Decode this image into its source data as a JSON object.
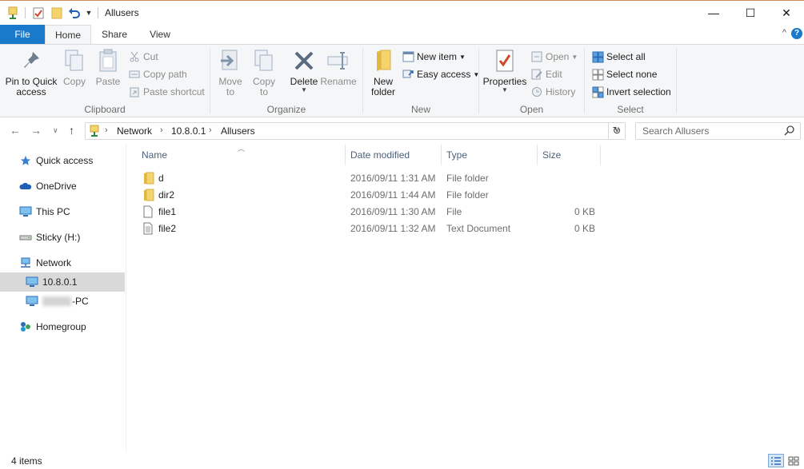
{
  "window": {
    "title": "Allusers",
    "minimize_glyph": "—",
    "maximize_glyph": "☐",
    "close_glyph": "✕"
  },
  "tabs": [
    {
      "label": "File"
    },
    {
      "label": "Home"
    },
    {
      "label": "Share"
    },
    {
      "label": "View"
    }
  ],
  "help_glyph": "?",
  "ribbon_caret": "^",
  "ribbon": {
    "clipboard": {
      "label": "Clipboard",
      "pin_label": "Pin to Quick\naccess",
      "copy_label": "Copy",
      "paste_label": "Paste",
      "cut_label": "Cut",
      "copy_path_label": "Copy path",
      "paste_shortcut_label": "Paste shortcut"
    },
    "organize": {
      "label": "Organize",
      "move_to_label": "Move\nto",
      "copy_to_label": "Copy\nto",
      "delete_label": "Delete",
      "rename_label": "Rename"
    },
    "new": {
      "label": "New",
      "new_folder_label": "New\nfolder",
      "new_item_label": "New item",
      "easy_access_label": "Easy access"
    },
    "open": {
      "label": "Open",
      "properties_label": "Properties",
      "open_label": "Open",
      "edit_label": "Edit",
      "history_label": "History"
    },
    "select": {
      "label": "Select",
      "select_all_label": "Select all",
      "select_none_label": "Select none",
      "invert_label": "Invert selection"
    }
  },
  "address": {
    "crumbs": [
      "Network",
      "10.8.0.1",
      "Allusers"
    ],
    "search_placeholder": "Search Allusers"
  },
  "nav_pane": [
    {
      "label": "Quick access",
      "icon": "star-icon"
    },
    {
      "label": "OneDrive",
      "icon": "cloud-icon"
    },
    {
      "label": "This PC",
      "icon": "monitor-icon"
    },
    {
      "label": "Sticky (H:)",
      "icon": "drive-icon"
    },
    {
      "label": "Network",
      "icon": "network-icon"
    },
    {
      "label": "10.8.0.1",
      "icon": "monitor-icon",
      "selected": true
    },
    {
      "label": "-PC",
      "icon": "monitor-icon"
    },
    {
      "label": "Homegroup",
      "icon": "homegroup-icon"
    }
  ],
  "columns": {
    "name": "Name",
    "date_modified": "Date modified",
    "type": "Type",
    "size": "Size"
  },
  "files": [
    {
      "name": "d",
      "date": "2016/09/11 1:31 AM",
      "type": "File folder",
      "size": "",
      "icon": "folder-icon"
    },
    {
      "name": "dir2",
      "date": "2016/09/11 1:44 AM",
      "type": "File folder",
      "size": "",
      "icon": "folder-icon"
    },
    {
      "name": "file1",
      "date": "2016/09/11 1:30 AM",
      "type": "File",
      "size": "0 KB",
      "icon": "file-icon"
    },
    {
      "name": "file2",
      "date": "2016/09/11 1:32 AM",
      "type": "Text Document",
      "size": "0 KB",
      "icon": "text-file-icon"
    }
  ],
  "status": {
    "item_count": "4 items"
  },
  "colors": {
    "accent": "#1979ca",
    "folder": "#f5d46b",
    "ribbon_bg": "#f5f6f7",
    "selected_nav": "#d9d9d9"
  }
}
